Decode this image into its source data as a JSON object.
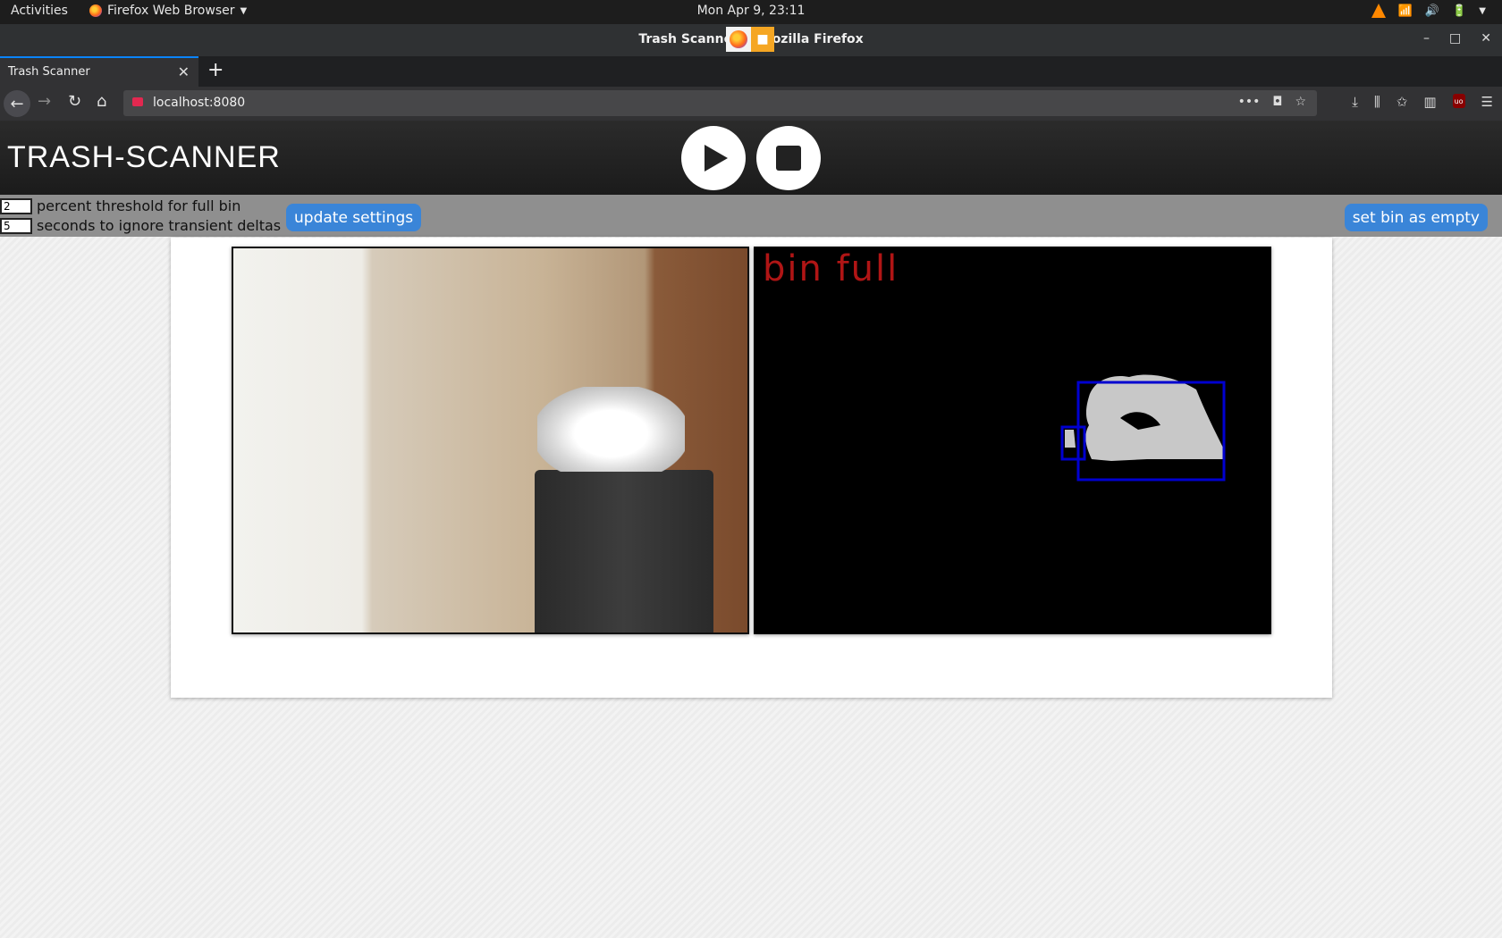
{
  "topbar": {
    "activities": "Activities",
    "app_menu": "Firefox Web Browser",
    "clock": "Mon Apr  9, 23:11"
  },
  "window": {
    "title": "Trash Scanner — Mozilla Firefox"
  },
  "tabs": [
    {
      "label": "Trash Scanner"
    }
  ],
  "nav": {
    "url": "localhost:8080"
  },
  "app": {
    "brand": "TRASH-SCANNER",
    "settings": {
      "threshold_value": "2",
      "threshold_label": "percent threshold for full bin",
      "transient_value": "5",
      "transient_label": "seconds to ignore transient deltas"
    },
    "update_button": "update settings",
    "empty_button": "set bin as empty",
    "processed_status": "bin full"
  },
  "colors": {
    "button_blue": "#3a85d8",
    "status_red": "#b01515",
    "box_blue": "#0000d0",
    "header_dark": "#1b1b1b"
  }
}
